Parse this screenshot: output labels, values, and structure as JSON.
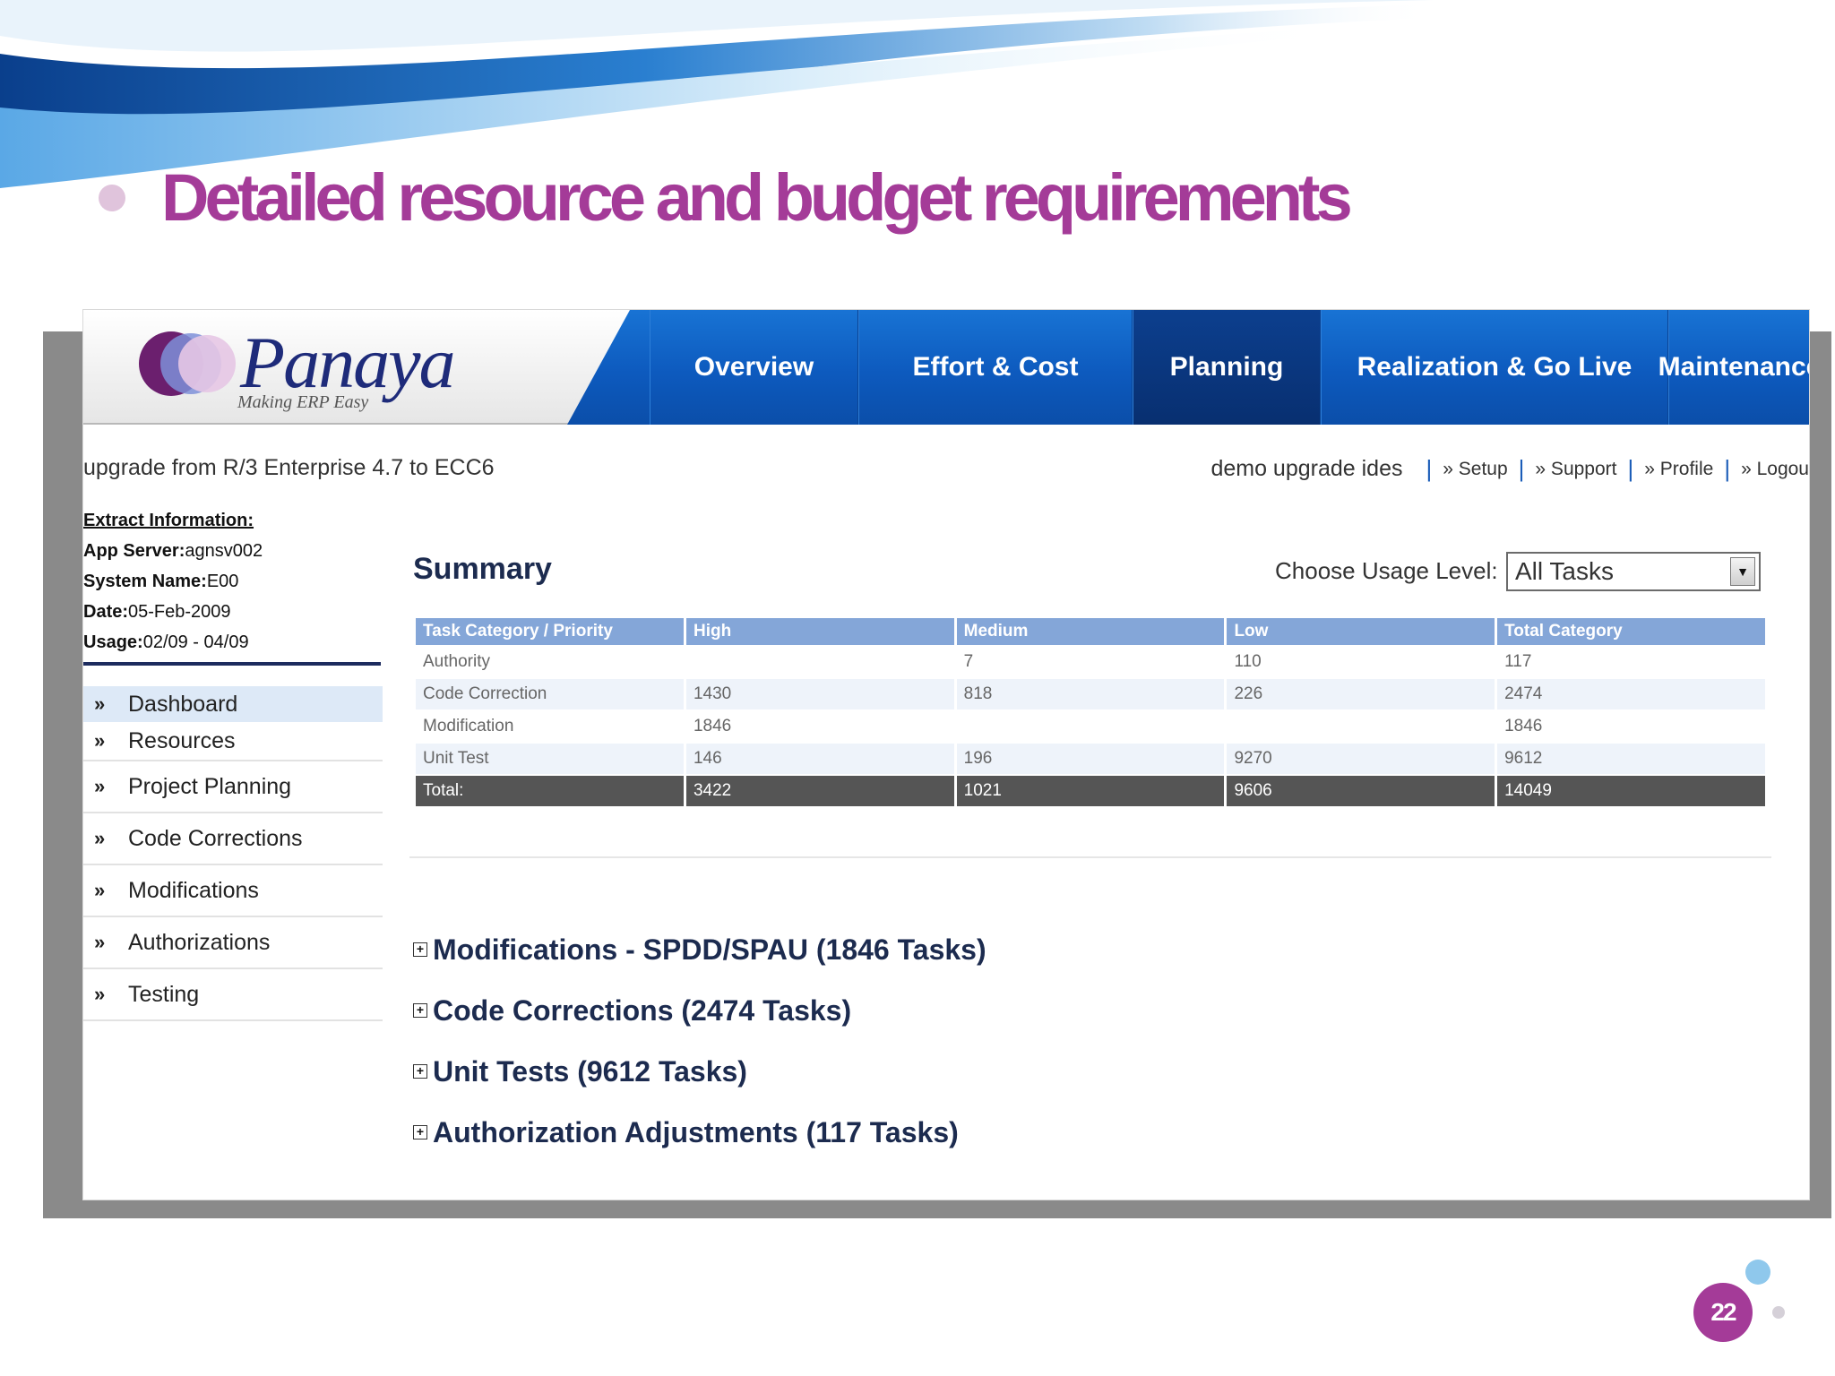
{
  "slide": {
    "title": "Detailed resource and budget requirements",
    "page_number": "22"
  },
  "header": {
    "logo_text": "Panaya",
    "logo_tagline": "Making ERP Easy",
    "tabs": [
      {
        "label": "Overview",
        "active": false
      },
      {
        "label": "Effort & Cost",
        "active": false
      },
      {
        "label": "Planning",
        "active": true
      },
      {
        "label": "Realization & Go Live",
        "active": false
      },
      {
        "label": "Maintenance",
        "active": false
      }
    ]
  },
  "project_line": "upgrade from R/3 Enterprise 4.7 to ECC6",
  "top_links": {
    "user": "demo upgrade ides",
    "setup": "» Setup",
    "support": "» Support",
    "profile": "» Profile",
    "logout": "» Logou"
  },
  "extract": {
    "title": "Extract Information:",
    "app_server_label": "App Server:",
    "app_server_value": "agnsv002",
    "system_name_label": "System Name:",
    "system_name_value": "E00",
    "date_label": "Date:",
    "date_value": "05-Feb-2009",
    "usage_label": "Usage:",
    "usage_value": "02/09 - 04/09"
  },
  "sidebar": {
    "chevron": "»",
    "items": [
      "Dashboard",
      "Resources",
      "Project Planning",
      "Code Corrections",
      "Modifications",
      "Authorizations",
      "Testing"
    ]
  },
  "summary": {
    "title": "Summary",
    "usage_label": "Choose Usage Level:",
    "usage_selected": "All Tasks",
    "columns": [
      "Task Category / Priority",
      "High",
      "Medium",
      "Low",
      "Total Category"
    ],
    "rows": [
      [
        "Authority",
        "",
        "7",
        "110",
        "117"
      ],
      [
        "Code Correction",
        "1430",
        "818",
        "226",
        "2474"
      ],
      [
        "Modification",
        "1846",
        "",
        "",
        "1846"
      ],
      [
        "Unit Test",
        "146",
        "196",
        "9270",
        "9612"
      ]
    ],
    "total": [
      "Total:",
      "3422",
      "1021",
      "9606",
      "14049"
    ]
  },
  "sections": [
    "Modifications - SPDD/SPAU (1846 Tasks)",
    "Code Corrections (2474 Tasks)",
    "Unit Tests (9612 Tasks)",
    "Authorization Adjustments (117 Tasks)"
  ],
  "colors": {
    "title_purple": "#a43b98",
    "nav_blue": "#0d5abe",
    "header_row_blue": "#84a6d8",
    "total_row_grey": "#555555"
  }
}
